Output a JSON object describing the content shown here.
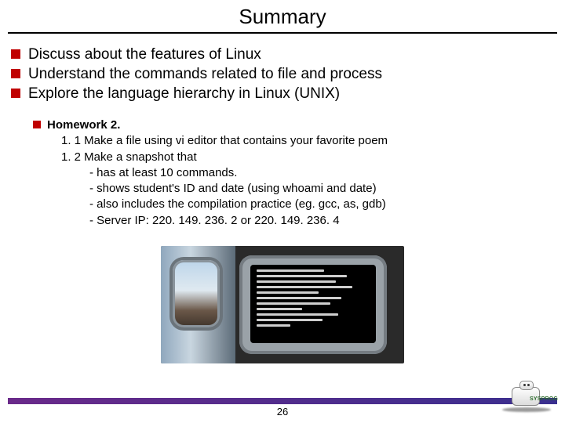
{
  "title": "Summary",
  "bullets": [
    "Discuss about the features of Linux",
    "Understand the commands related to file and process",
    "Explore the language hierarchy in Linux (UNIX)"
  ],
  "homework": {
    "heading": "Homework 2.",
    "items": [
      "1. 1 Make a file using vi editor that contains your favorite poem",
      "1. 2 Make a snapshot that"
    ],
    "subitems": [
      "- has at least 10 commands.",
      "- shows student's ID and date (using whoami and date)",
      "- also includes the compilation practice (eg. gcc, as, gdb)",
      "- Server IP: 220. 149. 236. 2 or  220. 149. 236. 4"
    ]
  },
  "logo_text": "SYSPROG",
  "page_number": "26"
}
